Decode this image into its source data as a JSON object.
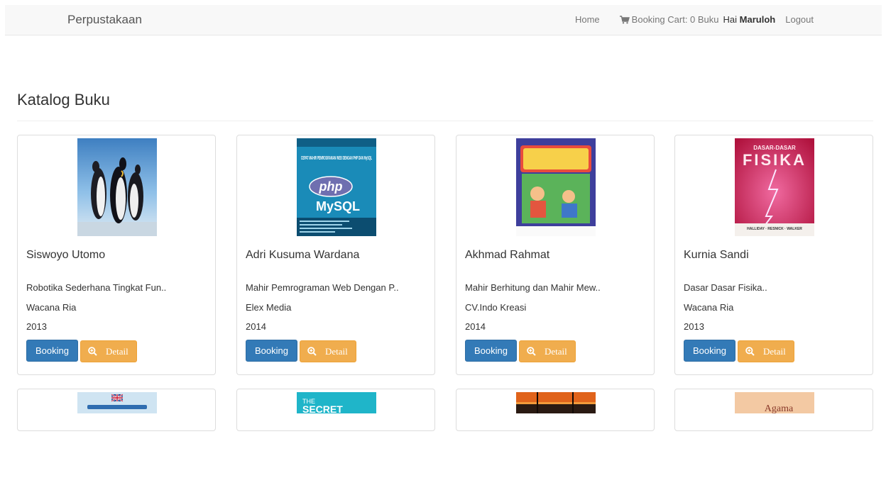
{
  "navbar": {
    "brand": "Perpustakaan",
    "home": "Home",
    "cart_label": "Booking Cart: 0 Buku",
    "greeting": "Hai",
    "username": "Maruloh",
    "logout": "Logout",
    "cart_icon": "shopping-cart-icon"
  },
  "page": {
    "title": "Katalog Buku"
  },
  "books": [
    {
      "author": "Siswoyo Utomo",
      "title": "Robotika Sederhana Tingkat Fun..",
      "publisher": "Wacana Ria",
      "year": "2013",
      "booking": "Booking",
      "detail": "Detail"
    },
    {
      "author": "Adri Kusuma Wardana",
      "title": "Mahir Pemrograman Web Dengan P..",
      "publisher": "Elex Media",
      "year": "2014",
      "booking": "Booking",
      "detail": "Detail"
    },
    {
      "author": "Akhmad Rahmat",
      "title": "Mahir Berhitung dan Mahir Mew..",
      "publisher": "CV.Indo Kreasi",
      "year": "2014",
      "booking": "Booking",
      "detail": "Detail"
    },
    {
      "author": "Kurnia Sandi",
      "title": "Dasar Dasar Fisika..",
      "publisher": "Wacana Ria",
      "year": "2013",
      "booking": "Booking",
      "detail": "Detail"
    }
  ],
  "covers": {
    "php_title": "CEPAT MAHIR PEMROGRAMAN WEB DENGAN PHP DAN MySQL",
    "php_logo": "php",
    "mysql_logo": "MySQL",
    "fisika_top": "DASAR-DASAR",
    "fisika_main": "FISIKA",
    "fisika_authors": "HALLIDAY · RESNICK · WALKER",
    "secret_the": "THE",
    "secret_main": "SECRET",
    "agama_text": "Agama"
  },
  "colors": {
    "primary": "#337ab7",
    "warning": "#f0ad4e",
    "navbar_bg": "#f8f8f8"
  }
}
